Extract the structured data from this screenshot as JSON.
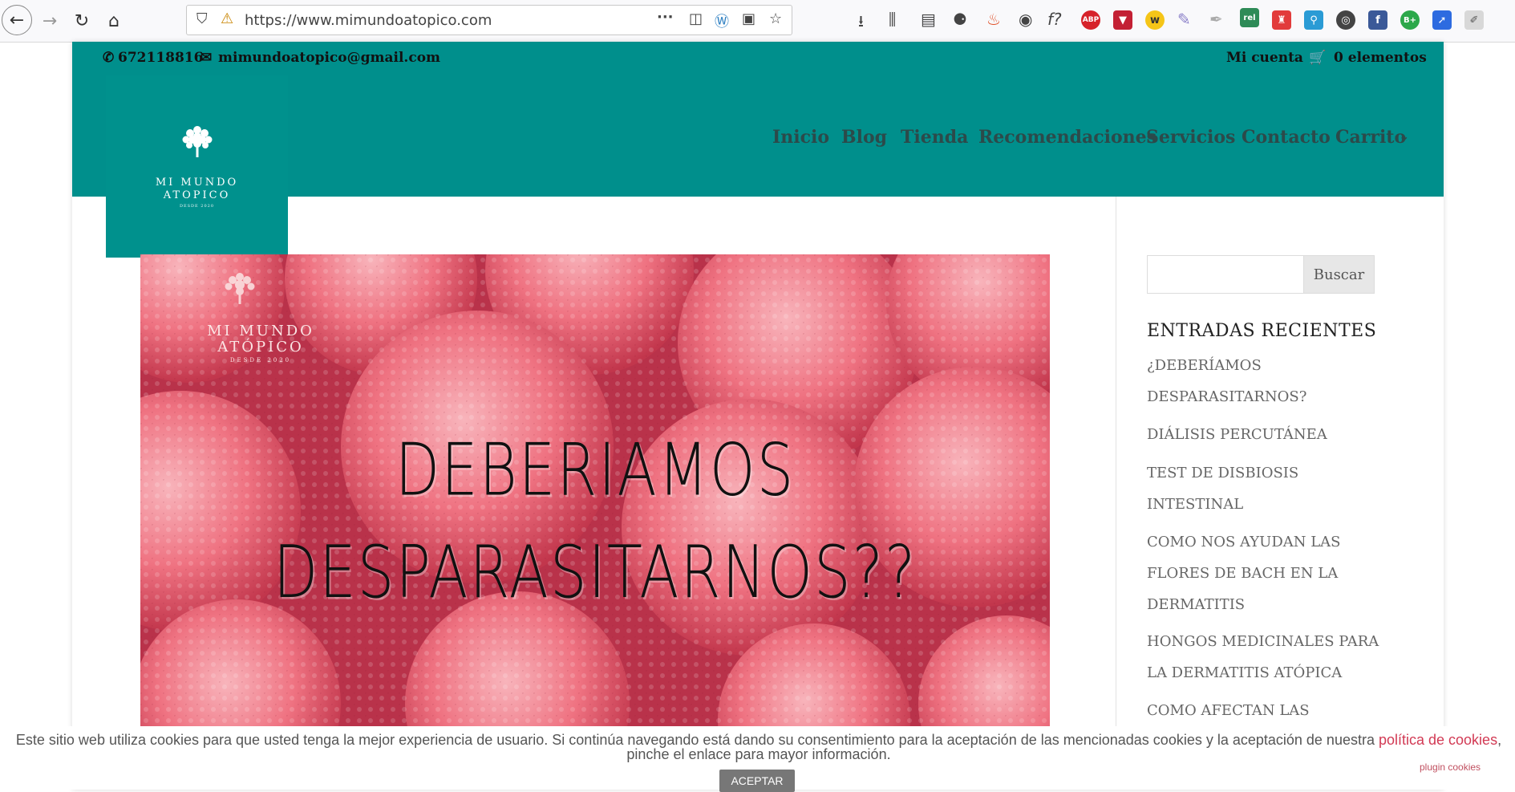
{
  "browser": {
    "back_icon": "back-arrow-icon",
    "forward_icon": "forward-arrow-icon",
    "reload_icon": "reload-icon",
    "home_icon": "home-icon",
    "url": "https://www.mimundoatopico.com",
    "menu_dots": "···",
    "extensions": [
      "download-icon",
      "library-icon",
      "reader-icon",
      "extension-icon",
      "fire-icon",
      "account-icon",
      "f-question-icon",
      "abp-icon",
      "pocket-icon",
      "w-icon",
      "pen-icon",
      "feather-icon",
      "rel-icon",
      "extension-red-icon",
      "search-key-icon",
      "chrome-icon",
      "facebook-icon",
      "b-plus-icon",
      "arrow-icon",
      "edit-icon"
    ],
    "ext_labels": {
      "abp": "ABP",
      "rel": "rel",
      "f": "f?",
      "w": "w",
      "b": "B+"
    }
  },
  "topbar": {
    "phone": "672118816",
    "email": "mimundoatopico@gmail.com",
    "account": "Mi cuenta",
    "cart": "0 elementos",
    "color": "#008f8c"
  },
  "logo": {
    "name_line1": "MI MUNDO",
    "name_line2": "ATOPICO",
    "since": "DESDE 2020"
  },
  "menu": {
    "items": [
      "Inicio",
      "Blog",
      "Tienda",
      "Recomendaciones",
      "Servicios",
      "Contacto",
      "Carrito"
    ]
  },
  "hero": {
    "title_line1": "DEBERIAMOS",
    "title_line2": "DESPARASITARNOS??",
    "logo_line1": "MI MUNDO",
    "logo_line2": "ATÓPICO",
    "logo_since": "DESDE 2020"
  },
  "sidebar": {
    "search_button": "Buscar",
    "recent_title": "ENTRADAS RECIENTES",
    "posts": [
      [
        "¿DEBERÍAMOS",
        "DESPARASITARNOS?"
      ],
      [
        "DIÁLISIS PERCUTÁNEA"
      ],
      [
        "TEST DE DISBIOSIS",
        "INTESTINAL"
      ],
      [
        "COMO NOS AYUDAN LAS",
        "FLORES DE BACH EN LA",
        "DERMATITIS"
      ],
      [
        "HONGOS MEDICINALES PARA",
        "LA DERMATITIS ATÓPICA"
      ],
      [
        "COMO AFECTAN LAS"
      ]
    ]
  },
  "cookie": {
    "text": "Este sitio web utiliza cookies para que usted tenga la mejor experiencia de usuario. Si continúa navegando está dando su consentimiento para la aceptación de las mencionadas cookies y la aceptación de nuestra ",
    "link": "política de cookies",
    "text_after": ", pinche el enlace para mayor información.",
    "accept": "ACEPTAR",
    "plugin": "plugin cookies"
  }
}
